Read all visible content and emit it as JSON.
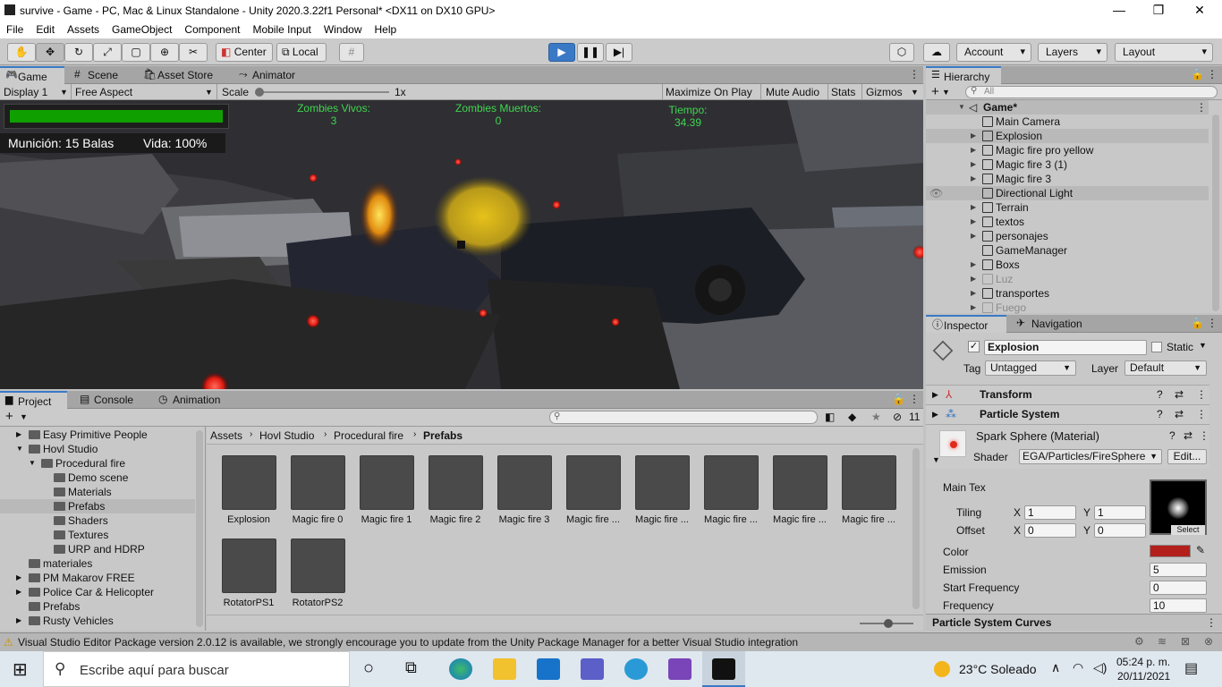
{
  "window": {
    "title": "survive - Game - PC, Mac & Linux Standalone - Unity 2020.3.22f1 Personal* <DX11 on DX10 GPU>",
    "minimize": "—",
    "maximize": "❐",
    "close": "✕"
  },
  "menu": [
    "File",
    "Edit",
    "Assets",
    "GameObject",
    "Component",
    "Mobile Input",
    "Window",
    "Help"
  ],
  "toolbar": {
    "pivot": "Center",
    "space": "Local",
    "account": "Account",
    "layers": "Layers",
    "layout": "Layout"
  },
  "game_tabs": [
    "Game",
    "Scene",
    "Asset Store",
    "Animator"
  ],
  "game_bar": {
    "display": "Display 1",
    "aspect": "Free Aspect",
    "scale_label": "Scale",
    "scale_value": "1x",
    "maximize": "Maximize On Play",
    "mute": "Mute Audio",
    "stats": "Stats",
    "gizmos": "Gizmos"
  },
  "hud": {
    "health_fill": 1.0,
    "zombies_alive_label": "Zombies Vivos:",
    "zombies_alive": "3",
    "zombies_dead_label": "Zombies Muertos:",
    "zombies_dead": "0",
    "time_label": "Tiempo:",
    "time_value": "34.39",
    "ammo": "Munición: 15 Balas",
    "life": "Vida: 100%"
  },
  "hierarchy": {
    "tab": "Hierarchy",
    "search_placeholder": "All",
    "scene": "Game*",
    "items": [
      {
        "label": "Main Camera",
        "expand": false,
        "dim": false
      },
      {
        "label": "Explosion",
        "expand": true,
        "dim": false,
        "selected": true
      },
      {
        "label": "Magic fire pro yellow",
        "expand": true,
        "dim": false
      },
      {
        "label": "Magic fire 3 (1)",
        "expand": true,
        "dim": false
      },
      {
        "label": "Magic fire 3",
        "expand": true,
        "dim": false
      },
      {
        "label": "Directional Light",
        "expand": false,
        "dim": false,
        "hovered": true
      },
      {
        "label": "Terrain",
        "expand": true,
        "dim": false
      },
      {
        "label": "textos",
        "expand": true,
        "dim": false
      },
      {
        "label": "personajes",
        "expand": true,
        "dim": false
      },
      {
        "label": "GameManager",
        "expand": false,
        "dim": false
      },
      {
        "label": "Boxs",
        "expand": true,
        "dim": false
      },
      {
        "label": "Luz",
        "expand": true,
        "dim": true
      },
      {
        "label": "transportes",
        "expand": true,
        "dim": false
      },
      {
        "label": "Fuego",
        "expand": true,
        "dim": true
      }
    ]
  },
  "inspector": {
    "tabs": [
      "Inspector",
      "Navigation"
    ],
    "object_name": "Explosion",
    "static_label": "Static",
    "tag_label": "Tag",
    "tag_value": "Untagged",
    "layer_label": "Layer",
    "layer_value": "Default",
    "components": [
      "Transform",
      "Particle System"
    ],
    "material_name": "Spark Sphere (Material)",
    "shader_label": "Shader",
    "shader_value": "EGA/Particles/FireSphere",
    "edit_btn": "Edit...",
    "main_tex": "Main Tex",
    "tiling": "Tiling",
    "offset": "Offset",
    "x": "X",
    "y": "Y",
    "tiling_x": "1",
    "tiling_y": "1",
    "offset_x": "0",
    "offset_y": "0",
    "select": "Select",
    "color_label": "Color",
    "color_value": "#b3201c",
    "emission_label": "Emission",
    "emission": "5",
    "start_freq_label": "Start Frequency",
    "start_freq": "0",
    "freq_label": "Frequency",
    "freq": "10",
    "curves": "Particle System Curves"
  },
  "project": {
    "tabs": [
      "Project",
      "Console",
      "Animation"
    ],
    "hidden_count": "11",
    "breadcrumb": [
      "Assets",
      "Hovl Studio",
      "Procedural fire",
      "Prefabs"
    ],
    "tree": [
      {
        "label": "Easy Primitive People",
        "indent": 0,
        "arrow": "right"
      },
      {
        "label": "Hovl Studio",
        "indent": 0,
        "arrow": "down"
      },
      {
        "label": "Procedural fire",
        "indent": 1,
        "arrow": "down"
      },
      {
        "label": "Demo scene",
        "indent": 2,
        "arrow": ""
      },
      {
        "label": "Materials",
        "indent": 2,
        "arrow": ""
      },
      {
        "label": "Prefabs",
        "indent": 2,
        "arrow": "",
        "selected": true
      },
      {
        "label": "Shaders",
        "indent": 2,
        "arrow": ""
      },
      {
        "label": "Textures",
        "indent": 2,
        "arrow": ""
      },
      {
        "label": "URP and HDRP",
        "indent": 2,
        "arrow": ""
      },
      {
        "label": "materiales",
        "indent": 0,
        "arrow": ""
      },
      {
        "label": "PM Makarov FREE",
        "indent": 0,
        "arrow": "right"
      },
      {
        "label": "Police Car & Helicopter",
        "indent": 0,
        "arrow": "right"
      },
      {
        "label": "Prefabs",
        "indent": 0,
        "arrow": ""
      },
      {
        "label": "Rusty Vehicles",
        "indent": 0,
        "arrow": "right"
      }
    ],
    "assets": [
      "Explosion",
      "Magic fire 0",
      "Magic fire 1",
      "Magic fire 2",
      "Magic fire 3",
      "Magic fire ...",
      "Magic fire ...",
      "Magic fire ...",
      "Magic fire ...",
      "Magic fire ...",
      "RotatorPS1",
      "RotatorPS2"
    ]
  },
  "status": "Visual Studio Editor Package version 2.0.12 is available, we strongly encourage you to update from the Unity Package Manager for a better Visual Studio integration",
  "taskbar": {
    "search": "Escribe aquí para buscar",
    "weather": "23°C  Soleado",
    "time": "05:24 p. m.",
    "date": "20/11/2021"
  }
}
